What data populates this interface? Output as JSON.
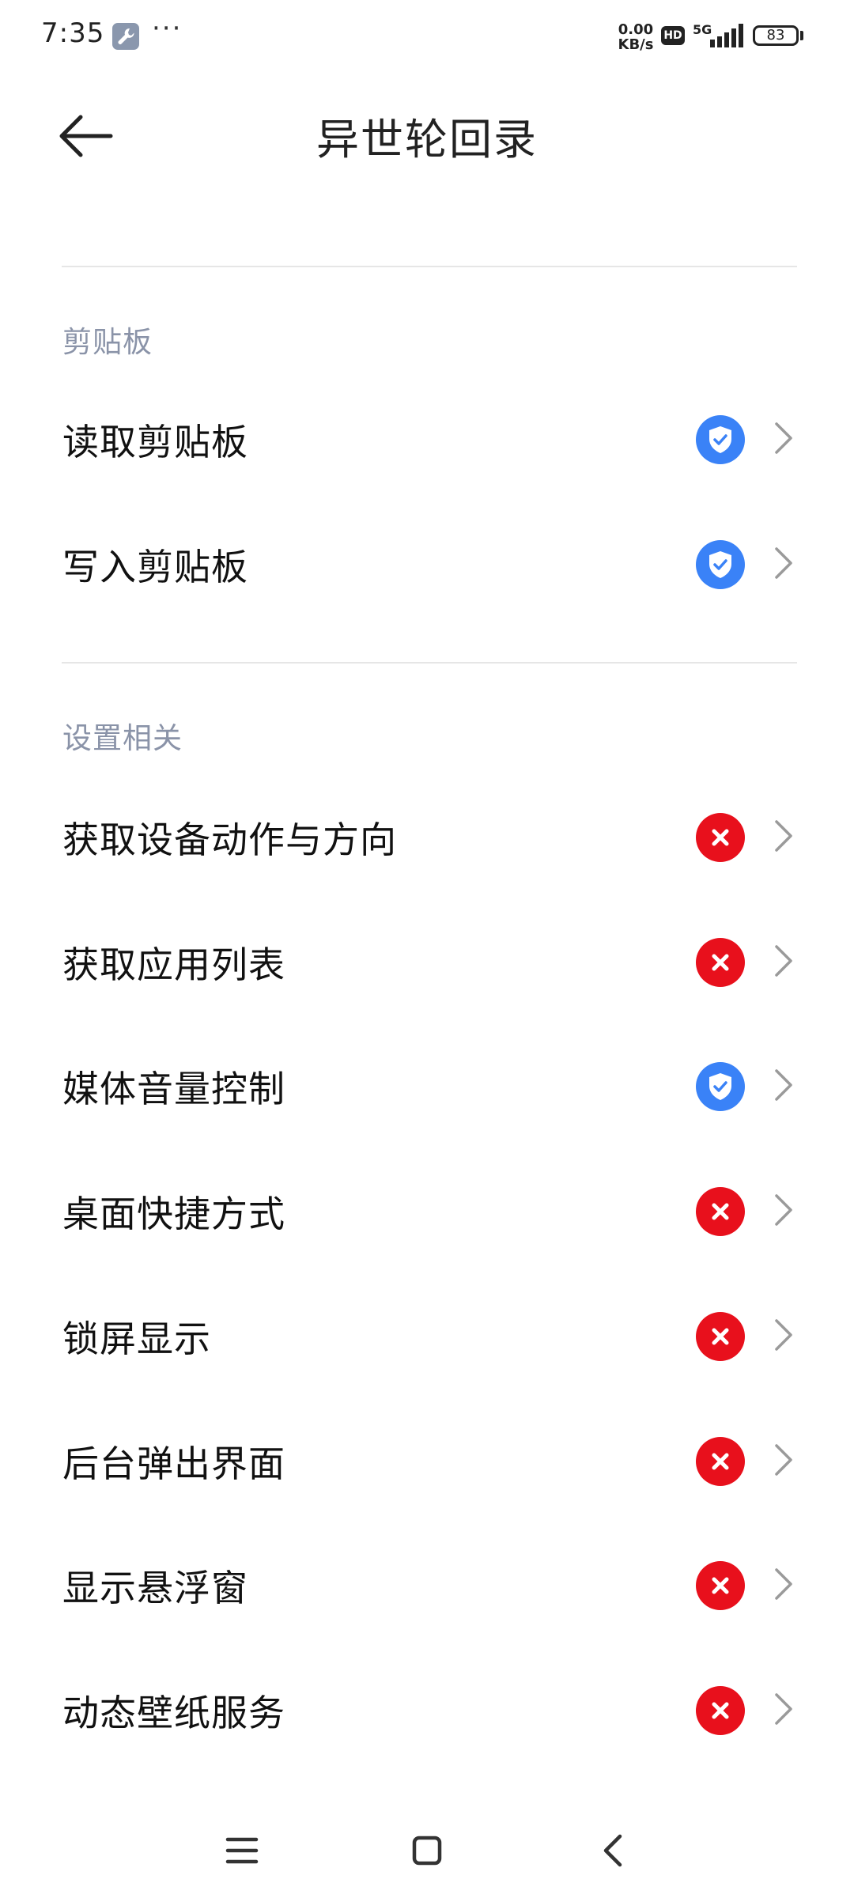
{
  "status_bar": {
    "time": "7:35",
    "dots": "···",
    "network_speed_value": "0.00",
    "network_speed_unit": "KB/s",
    "hd_badge": "HD",
    "network_type": "5G",
    "battery_level": "83"
  },
  "header": {
    "title": "异世轮回录"
  },
  "sections": [
    {
      "title": "剪贴板",
      "items": [
        {
          "label": "读取剪贴板",
          "status": "granted"
        },
        {
          "label": "写入剪贴板",
          "status": "granted"
        }
      ]
    },
    {
      "title": "设置相关",
      "items": [
        {
          "label": "获取设备动作与方向",
          "status": "denied"
        },
        {
          "label": "获取应用列表",
          "status": "denied"
        },
        {
          "label": "媒体音量控制",
          "status": "granted"
        },
        {
          "label": "桌面快捷方式",
          "status": "denied"
        },
        {
          "label": "锁屏显示",
          "status": "denied"
        },
        {
          "label": "后台弹出界面",
          "status": "denied"
        },
        {
          "label": "显示悬浮窗",
          "status": "denied"
        },
        {
          "label": "动态壁纸服务",
          "status": "denied"
        }
      ]
    }
  ],
  "colors": {
    "granted": "#3a82f7",
    "denied": "#e8101c",
    "section_title": "#8a93a8"
  },
  "icons": {
    "granted": "shield-check-icon",
    "denied": "cross-icon",
    "chevron": "chevron-right-icon",
    "back": "back-arrow-icon"
  }
}
